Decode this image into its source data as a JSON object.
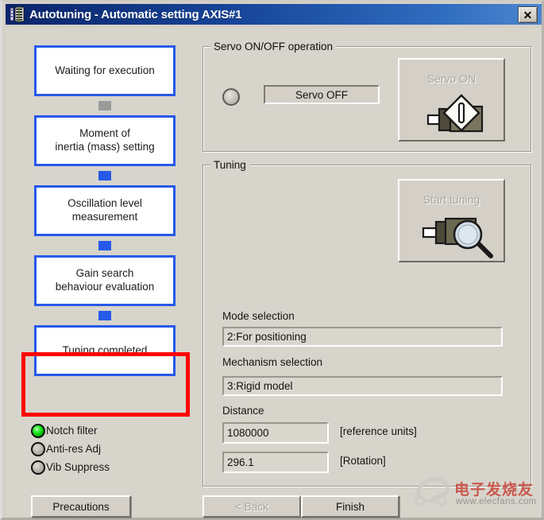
{
  "window": {
    "title": "Autotuning - Automatic setting AXIS#1",
    "icon": "app-tuning-icon",
    "close_label": "✕"
  },
  "flow": {
    "steps": [
      {
        "label": "Waiting for execution",
        "connector_after": "inactive"
      },
      {
        "label": "Moment of\ninertia (mass) setting",
        "connector_after": "active"
      },
      {
        "label": "Oscillation level\nmeasurement",
        "connector_after": "active"
      },
      {
        "label": "Gain search\nbehaviour evaluation",
        "connector_after": "active"
      },
      {
        "label": "Tuning completed",
        "connector_after": "none"
      }
    ],
    "highlight_color": "#ff0000",
    "box_border_color": "#2659e8",
    "connector_active_color": "#2659e8",
    "connector_inactive_color": "#9a9a9a"
  },
  "indicators": [
    {
      "label": "Notch filter",
      "state": "on",
      "color": "#22d522"
    },
    {
      "label": "Anti-res Adj",
      "state": "off",
      "color": "#bdb9b1"
    },
    {
      "label": "Vib Suppress",
      "state": "off",
      "color": "#bdb9b1"
    }
  ],
  "servo_group": {
    "title": "Servo ON/OFF operation",
    "status_text": "Servo OFF",
    "button_label": "Servo ON",
    "button_icon": "servo-plug-power-icon",
    "button_enabled": false
  },
  "tuning_group": {
    "title": "Tuning",
    "button_label": "Start tuning",
    "button_icon": "plug-magnifier-icon",
    "button_enabled": false,
    "fields": [
      {
        "label": "Mode selection",
        "value": "2:For positioning",
        "unit": ""
      },
      {
        "label": "Mechanism selection",
        "value": "3:Rigid model",
        "unit": ""
      },
      {
        "label": "Distance",
        "value": "1080000",
        "unit": "[reference units]"
      },
      {
        "label": "",
        "value": "296.1",
        "unit": "[Rotation]"
      }
    ]
  },
  "footer": {
    "precautions_label": "Precautions",
    "back_label": "< Back",
    "back_enabled": false,
    "finish_label": "Finish",
    "finish_enabled": true
  },
  "watermark": {
    "text_cn": "电子发烧友",
    "url": "www.elecfans.com"
  }
}
